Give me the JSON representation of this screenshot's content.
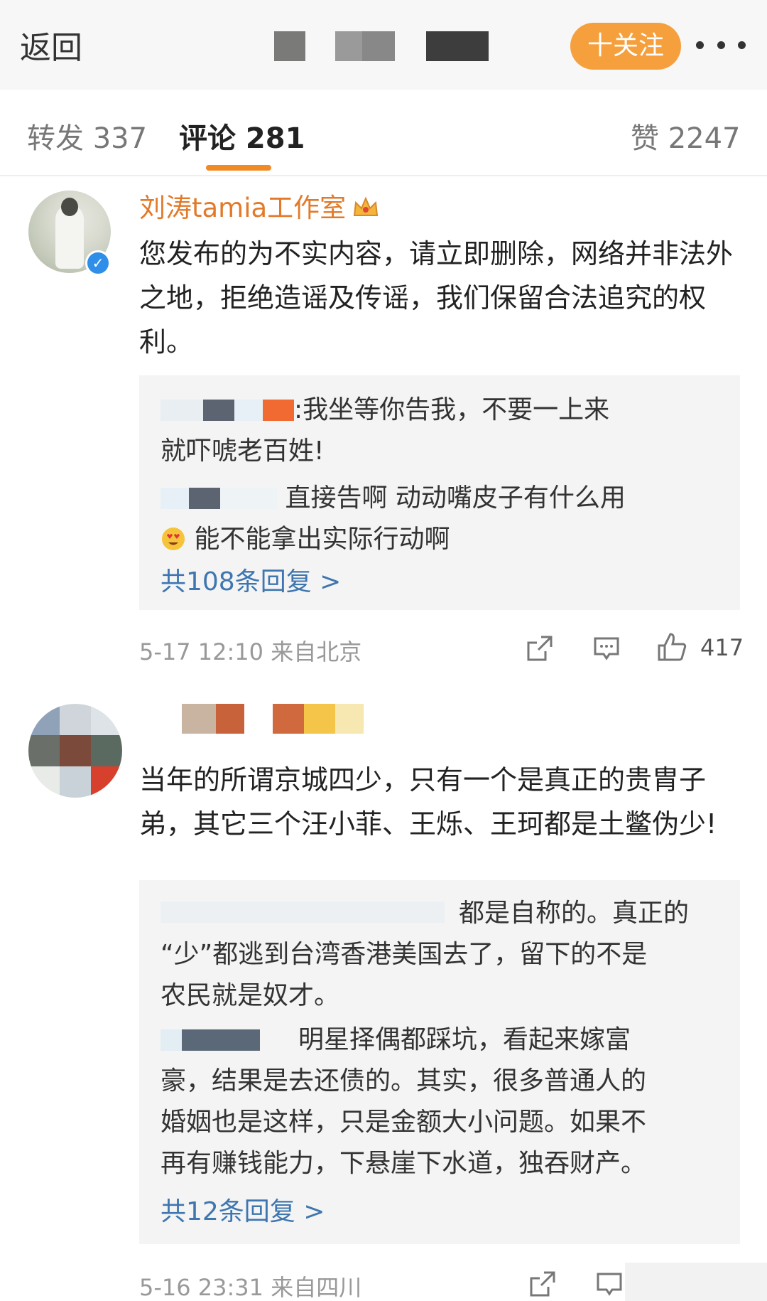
{
  "topbar": {
    "back_label": "返回",
    "follow_label": "十关注",
    "blurred_title_colors": [
      "#7a7a78",
      "#9a9a9a",
      "#888888",
      "#3d3d3d"
    ]
  },
  "tabs": [
    {
      "label": "转发 337"
    },
    {
      "label": "评论 281"
    },
    {
      "label": "赞 2247"
    }
  ],
  "colors": {
    "accent_orange": "#f08a24",
    "username_orange": "#e27a2a",
    "link_blue": "#3e76b0",
    "verify_blue": "#2e8ee8"
  },
  "comments": [
    {
      "username": "刘涛tamia工作室",
      "verified": true,
      "text": "您发布的为不实内容，请立即删除，网络并非法外之地，拒绝造谣及传谣，我们保留合法追究的权利。",
      "replies": [
        {
          "text_line1": ":我坐等你告我，不要一上来",
          "text_line2": "就吓唬老百姓!"
        },
        {
          "text_line1": "直接告啊 动动嘴皮子有什么用",
          "text_line2": "能不能拿出实际行动啊",
          "emoji": "heart-eyes-emoji"
        }
      ],
      "more_replies": "共108条回复 >",
      "meta": "5-17 12:10 来自北京",
      "likes": "417"
    },
    {
      "username": "",
      "text": "当年的所谓京城四少，只有一个是真正的贵胄子弟，其它三个汪小菲、王烁、王珂都是土鳖伪少!",
      "replies": [
        {
          "text_line1": "都是自称的。真正的",
          "text_line2": "“少”都逃到台湾香港美国去了，留下的不是",
          "text_line3": "农民就是奴才。"
        },
        {
          "text_line1": "明星择偶都踩坑，看起来嫁富",
          "text_line2": "豪，结果是去还债的。其实，很多普通人的",
          "text_line3": "婚姻也是这样，只是金额大小问题。如果不",
          "text_line4": "再有赚钱能力，下悬崖下水道，独吞财产。"
        }
      ],
      "more_replies": "共12条回复 >",
      "meta": "5-16 23:31 来自四川"
    }
  ]
}
